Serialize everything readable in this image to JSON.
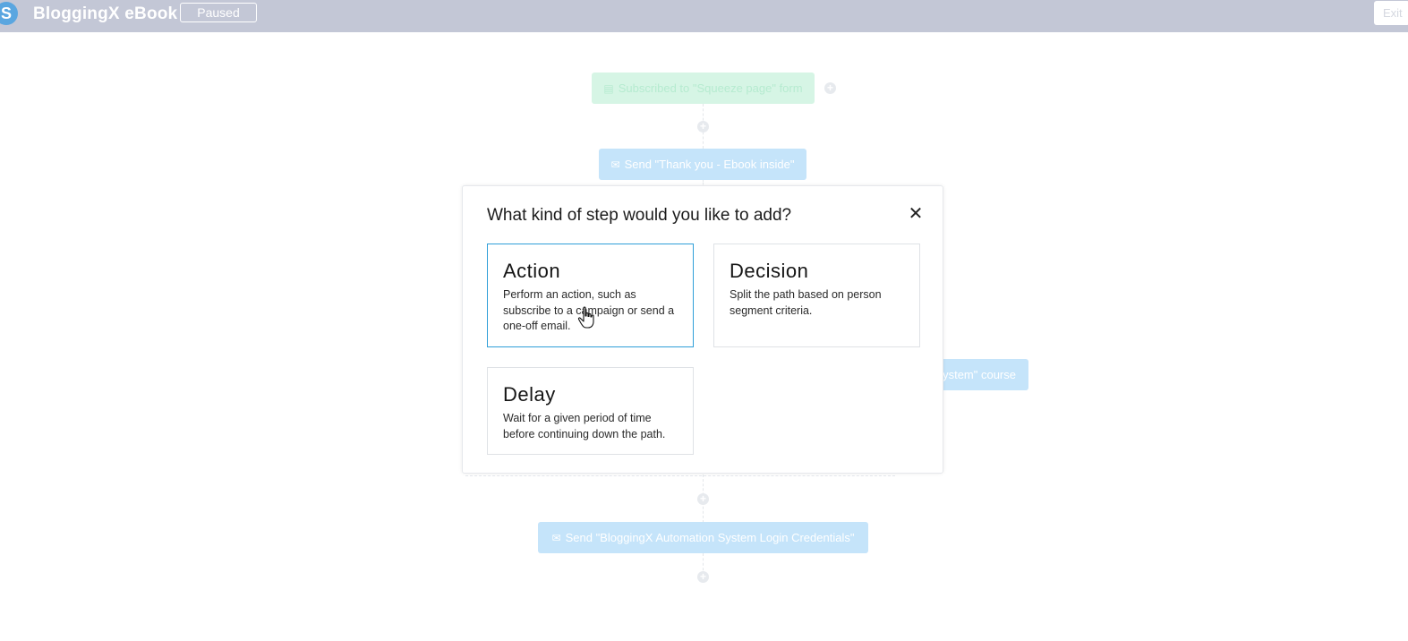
{
  "header": {
    "logo_letter": "S",
    "title": "BloggingX eBook",
    "status": "Paused",
    "exit_label": "Exit"
  },
  "workflow": {
    "trigger": "Subscribed to \"Squeeze page\" form",
    "step1": "Send \"Thank you - Ebook inside\"",
    "step_partial": "ystem\" course",
    "step_last": "Send \"BloggingX Automation System Login Credentials\""
  },
  "dialog": {
    "title": "What kind of step would you like to add?",
    "close_label": "✕",
    "options": [
      {
        "title": "Action",
        "description": "Perform an action, such as subscribe to a campaign or send a one-off email."
      },
      {
        "title": "Decision",
        "description": "Split the path based on person segment criteria."
      },
      {
        "title": "Delay",
        "description": "Wait for a given period of time before continuing down the path."
      }
    ]
  },
  "colors": {
    "topbar": "#c3c7d6",
    "selected_border": "#2f9fd8",
    "node_blue": "#c5e4fa",
    "node_green": "#d6f5e5"
  }
}
